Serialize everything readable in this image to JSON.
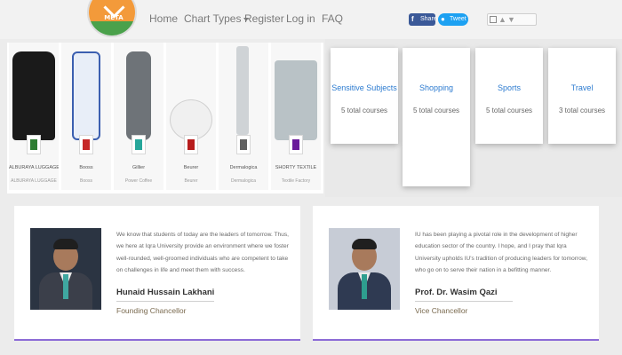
{
  "nav": {
    "logo_text": "META",
    "links": [
      "Home",
      "Chart Types",
      "Register",
      "Log in",
      "FAQ"
    ],
    "share_label": "Share",
    "tweet_label": "Tweet"
  },
  "products": [
    {
      "name": "ALBURAYA LUGGAGE",
      "sub": "ALBURAYA LUGGAGE",
      "color": "#1a1a1a",
      "badge": "#2e7d32"
    },
    {
      "name": "Booss",
      "sub": "Booss",
      "color": "#e8eef8",
      "badge": "#c62828"
    },
    {
      "name": "Gillier",
      "sub": "Power Coffee",
      "color": "#6e7378",
      "badge": "#26a69a"
    },
    {
      "name": "Beurer",
      "sub": "Beurer",
      "color": "#f0f0f0",
      "badge": "#b71c1c"
    },
    {
      "name": "Dermalogica",
      "sub": "Dermalogica",
      "color": "#cfd3d6",
      "badge": "#616161"
    },
    {
      "name": "SHORTY TEXTILE",
      "sub": "Textile Factory",
      "color": "#b9c2c6",
      "badge": "#6a1b9a"
    }
  ],
  "categories": [
    {
      "title": "Sensitive Subjects",
      "count": "5 total courses"
    },
    {
      "title": "Shopping",
      "count": "5 total courses"
    },
    {
      "title": "Sports",
      "count": "5 total courses"
    },
    {
      "title": "Travel",
      "count": "3 total courses"
    }
  ],
  "quotes": [
    {
      "text": "We know that students of today are the leaders of tomorrow. Thus, we here at Iqra University provide an environment where we foster well-rounded, well-groomed individuals who are competent to take on challenges in life and meet them with success.",
      "name": "Hunaid Hussain Lakhani",
      "role": "Founding Chancellor"
    },
    {
      "text": "IU has been playing a pivotal role in the development of higher education sector of the country. I hope, and I pray that Iqra University upholds IU's tradition of producing leaders for tomorrow, who go on to serve their nation in a befitting manner.",
      "name": "Prof. Dr. Wasim Qazi",
      "role": "Vice Chancellor"
    }
  ]
}
